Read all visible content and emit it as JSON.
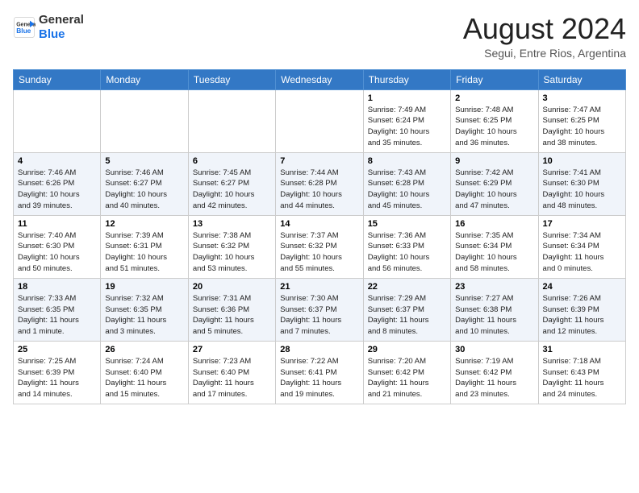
{
  "header": {
    "logo_line1": "General",
    "logo_line2": "Blue",
    "month": "August 2024",
    "location": "Segui, Entre Rios, Argentina"
  },
  "weekdays": [
    "Sunday",
    "Monday",
    "Tuesday",
    "Wednesday",
    "Thursday",
    "Friday",
    "Saturday"
  ],
  "weeks": [
    [
      {
        "day": "",
        "info": ""
      },
      {
        "day": "",
        "info": ""
      },
      {
        "day": "",
        "info": ""
      },
      {
        "day": "",
        "info": ""
      },
      {
        "day": "1",
        "info": "Sunrise: 7:49 AM\nSunset: 6:24 PM\nDaylight: 10 hours\nand 35 minutes."
      },
      {
        "day": "2",
        "info": "Sunrise: 7:48 AM\nSunset: 6:25 PM\nDaylight: 10 hours\nand 36 minutes."
      },
      {
        "day": "3",
        "info": "Sunrise: 7:47 AM\nSunset: 6:25 PM\nDaylight: 10 hours\nand 38 minutes."
      }
    ],
    [
      {
        "day": "4",
        "info": "Sunrise: 7:46 AM\nSunset: 6:26 PM\nDaylight: 10 hours\nand 39 minutes."
      },
      {
        "day": "5",
        "info": "Sunrise: 7:46 AM\nSunset: 6:27 PM\nDaylight: 10 hours\nand 40 minutes."
      },
      {
        "day": "6",
        "info": "Sunrise: 7:45 AM\nSunset: 6:27 PM\nDaylight: 10 hours\nand 42 minutes."
      },
      {
        "day": "7",
        "info": "Sunrise: 7:44 AM\nSunset: 6:28 PM\nDaylight: 10 hours\nand 44 minutes."
      },
      {
        "day": "8",
        "info": "Sunrise: 7:43 AM\nSunset: 6:28 PM\nDaylight: 10 hours\nand 45 minutes."
      },
      {
        "day": "9",
        "info": "Sunrise: 7:42 AM\nSunset: 6:29 PM\nDaylight: 10 hours\nand 47 minutes."
      },
      {
        "day": "10",
        "info": "Sunrise: 7:41 AM\nSunset: 6:30 PM\nDaylight: 10 hours\nand 48 minutes."
      }
    ],
    [
      {
        "day": "11",
        "info": "Sunrise: 7:40 AM\nSunset: 6:30 PM\nDaylight: 10 hours\nand 50 minutes."
      },
      {
        "day": "12",
        "info": "Sunrise: 7:39 AM\nSunset: 6:31 PM\nDaylight: 10 hours\nand 51 minutes."
      },
      {
        "day": "13",
        "info": "Sunrise: 7:38 AM\nSunset: 6:32 PM\nDaylight: 10 hours\nand 53 minutes."
      },
      {
        "day": "14",
        "info": "Sunrise: 7:37 AM\nSunset: 6:32 PM\nDaylight: 10 hours\nand 55 minutes."
      },
      {
        "day": "15",
        "info": "Sunrise: 7:36 AM\nSunset: 6:33 PM\nDaylight: 10 hours\nand 56 minutes."
      },
      {
        "day": "16",
        "info": "Sunrise: 7:35 AM\nSunset: 6:34 PM\nDaylight: 10 hours\nand 58 minutes."
      },
      {
        "day": "17",
        "info": "Sunrise: 7:34 AM\nSunset: 6:34 PM\nDaylight: 11 hours\nand 0 minutes."
      }
    ],
    [
      {
        "day": "18",
        "info": "Sunrise: 7:33 AM\nSunset: 6:35 PM\nDaylight: 11 hours\nand 1 minute."
      },
      {
        "day": "19",
        "info": "Sunrise: 7:32 AM\nSunset: 6:35 PM\nDaylight: 11 hours\nand 3 minutes."
      },
      {
        "day": "20",
        "info": "Sunrise: 7:31 AM\nSunset: 6:36 PM\nDaylight: 11 hours\nand 5 minutes."
      },
      {
        "day": "21",
        "info": "Sunrise: 7:30 AM\nSunset: 6:37 PM\nDaylight: 11 hours\nand 7 minutes."
      },
      {
        "day": "22",
        "info": "Sunrise: 7:29 AM\nSunset: 6:37 PM\nDaylight: 11 hours\nand 8 minutes."
      },
      {
        "day": "23",
        "info": "Sunrise: 7:27 AM\nSunset: 6:38 PM\nDaylight: 11 hours\nand 10 minutes."
      },
      {
        "day": "24",
        "info": "Sunrise: 7:26 AM\nSunset: 6:39 PM\nDaylight: 11 hours\nand 12 minutes."
      }
    ],
    [
      {
        "day": "25",
        "info": "Sunrise: 7:25 AM\nSunset: 6:39 PM\nDaylight: 11 hours\nand 14 minutes."
      },
      {
        "day": "26",
        "info": "Sunrise: 7:24 AM\nSunset: 6:40 PM\nDaylight: 11 hours\nand 15 minutes."
      },
      {
        "day": "27",
        "info": "Sunrise: 7:23 AM\nSunset: 6:40 PM\nDaylight: 11 hours\nand 17 minutes."
      },
      {
        "day": "28",
        "info": "Sunrise: 7:22 AM\nSunset: 6:41 PM\nDaylight: 11 hours\nand 19 minutes."
      },
      {
        "day": "29",
        "info": "Sunrise: 7:20 AM\nSunset: 6:42 PM\nDaylight: 11 hours\nand 21 minutes."
      },
      {
        "day": "30",
        "info": "Sunrise: 7:19 AM\nSunset: 6:42 PM\nDaylight: 11 hours\nand 23 minutes."
      },
      {
        "day": "31",
        "info": "Sunrise: 7:18 AM\nSunset: 6:43 PM\nDaylight: 11 hours\nand 24 minutes."
      }
    ]
  ]
}
